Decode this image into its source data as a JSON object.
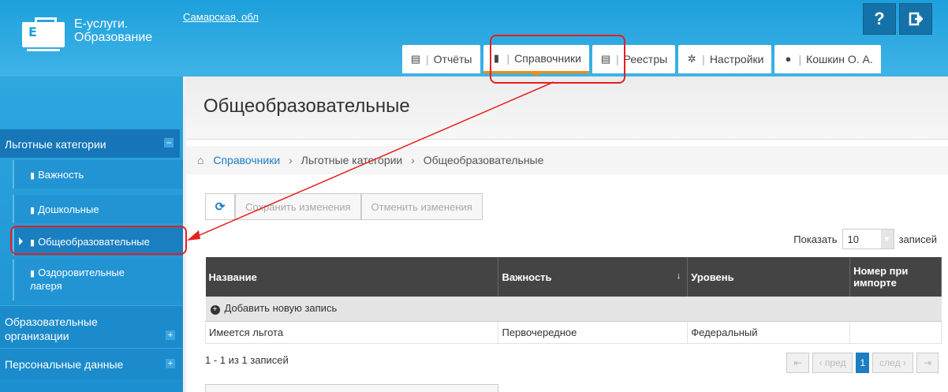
{
  "app": {
    "title_line1": "Е-услуги.",
    "title_line2": "Образование",
    "region": "Самарская, обл",
    "help_label": "?",
    "exit_icon": "logout-icon"
  },
  "tabs": [
    {
      "label": "Отчёты",
      "icon": "report-icon",
      "active": false
    },
    {
      "label": "Справочники",
      "icon": "book-icon",
      "active": true
    },
    {
      "label": "Реестры",
      "icon": "list-icon",
      "active": false
    },
    {
      "label": "Настройки",
      "icon": "gear-icon",
      "active": false
    },
    {
      "label": "Кошкин О. А.",
      "icon": "user-icon",
      "active": false
    }
  ],
  "sidebar": {
    "section": "Льготные категории",
    "section_toggle": "−",
    "items": [
      {
        "label": "Важность"
      },
      {
        "label": "Дошкольные"
      },
      {
        "label": "Общеобразовательные"
      },
      {
        "label_line1": "Оздоровительные",
        "label_line2": "лагеря"
      }
    ],
    "groups": [
      {
        "label_line1": "Образовательные",
        "label_line2": "организации",
        "toggle": "+"
      },
      {
        "label": "Персональные данные",
        "toggle": "+"
      }
    ]
  },
  "main": {
    "title": "Общеобразовательные",
    "breadcrumb": [
      "Справочники",
      "Льготные категории",
      "Общеобразовательные"
    ],
    "toolbar": {
      "save_label": "Сохранить изменения",
      "cancel_label": "Отменить изменения"
    },
    "show": {
      "prefix": "Показать",
      "value": "10",
      "suffix": "записей"
    },
    "table": {
      "columns": [
        "Название",
        "Важность",
        "Уровень",
        "Номер при импорте"
      ],
      "add_label": "Добавить новую запись",
      "rows": [
        {
          "name": "Имеется льгота",
          "importance": "Первочередное",
          "level": "Федеральный",
          "import_no": ""
        }
      ]
    },
    "records": "1 - 1 из 1 записей",
    "pager": {
      "prev": "пред",
      "page": "1",
      "next": "след"
    }
  },
  "colors": {
    "header": "#1da0dc",
    "accent": "#ff8a00",
    "annotation": "#e52020",
    "link": "#1c7ec3"
  }
}
